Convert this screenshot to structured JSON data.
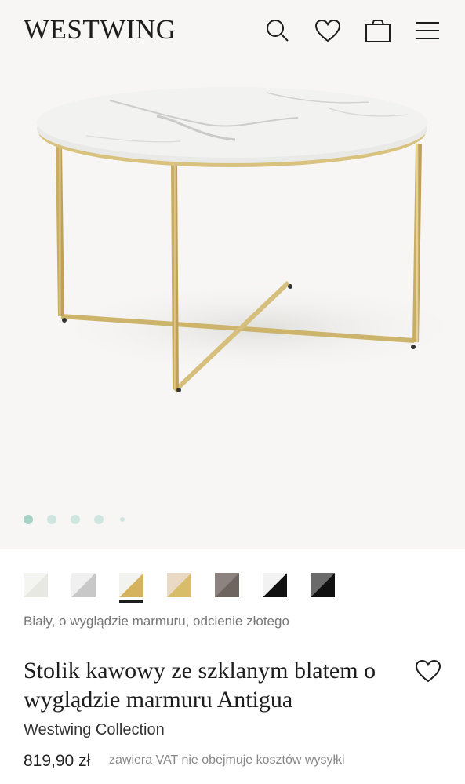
{
  "header": {
    "logo": "WESTWING",
    "icons": [
      "search-icon",
      "heart-icon",
      "bag-icon",
      "menu-icon"
    ]
  },
  "gallery": {
    "slides_total": 5,
    "active_slide": 1
  },
  "variants": {
    "swatches": [
      {
        "name": "white-marble",
        "colors": [
          "#e8e8e3",
          "#f4f4f0"
        ]
      },
      {
        "name": "white-marble-silver",
        "colors": [
          "#c8c8c8",
          "#f0f0f0"
        ]
      },
      {
        "name": "white-marble-gold",
        "colors": [
          "#d4b35c",
          "#f2f2ee"
        ],
        "selected": true
      },
      {
        "name": "beige-marble-gold",
        "colors": [
          "#d7bc6a",
          "#ead9c4"
        ]
      },
      {
        "name": "grey-brown",
        "colors": [
          "#6f6560",
          "#8c8380"
        ]
      },
      {
        "name": "black-white",
        "colors": [
          "#111111",
          "#f2f2f2"
        ]
      },
      {
        "name": "black-grey",
        "colors": [
          "#111111",
          "#6a6a6a"
        ]
      }
    ],
    "selected_label": "Biały, o wyglądzie marmuru, odcienie złotego"
  },
  "product": {
    "title": "Stolik kawowy ze szklanym blatem o wyglądzie marmuru Antigua",
    "brand": "Westwing Collection",
    "price": "819,90 zł",
    "vat_note": "zawiera VAT nie obejmuje kosztów wysyłki"
  },
  "colors": {
    "accent_dot": "#a6d2c6",
    "gold": "#d4b35c"
  }
}
